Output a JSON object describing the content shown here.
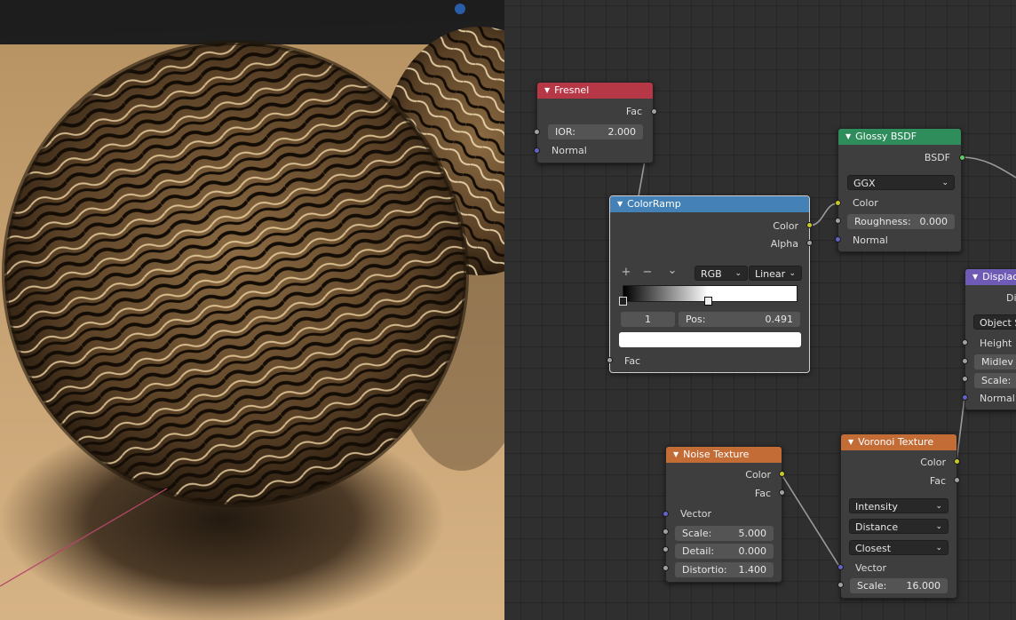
{
  "colors": {
    "fresnel_header": "#b63746",
    "glossy_header": "#2f8d5b",
    "colorramp_header": "#4381b6",
    "noise_header": "#c36c36",
    "voronoi_header": "#c36c36",
    "displacement_header": "#6f5bb6"
  },
  "viewport": {
    "indicator_icon": "blue-circle"
  },
  "nodes": {
    "fresnel": {
      "title": "Fresnel",
      "out_fac": "Fac",
      "ior_label": "IOR:",
      "ior_value": "2.000",
      "normal": "Normal"
    },
    "glossy": {
      "title": "Glossy BSDF",
      "out_bsdf": "BSDF",
      "distribution": "GGX",
      "color": "Color",
      "roughness_label": "Roughness:",
      "roughness_value": "0.000",
      "normal": "Normal"
    },
    "colorramp": {
      "title": "ColorRamp",
      "out_color": "Color",
      "out_alpha": "Alpha",
      "add_btn": "+",
      "remove_btn": "−",
      "menu_btn": "⌄",
      "color_mode": "RGB",
      "interpolation": "Linear",
      "active_stop": "1",
      "pos_label": "Pos:",
      "pos_value": "0.491",
      "in_fac": "Fac"
    },
    "noise": {
      "title": "Noise Texture",
      "out_color": "Color",
      "out_fac": "Fac",
      "vector": "Vector",
      "scale_label": "Scale:",
      "scale_value": "5.000",
      "detail_label": "Detail:",
      "detail_value": "0.000",
      "distortion_label": "Distortio:",
      "distortion_value": "1.400"
    },
    "voronoi": {
      "title": "Voronoi Texture",
      "out_color": "Color",
      "out_fac": "Fac",
      "coloring": "Intensity",
      "distance": "Distance",
      "feature": "Closest",
      "vector": "Vector",
      "scale_label": "Scale:",
      "scale_value": "16.000"
    },
    "displacement": {
      "title": "Displac",
      "out_disp": "Dis",
      "space": "Object S",
      "height": "Height",
      "midlevel": "Midlev",
      "scale": "Scale:",
      "normal": "Normal"
    }
  }
}
